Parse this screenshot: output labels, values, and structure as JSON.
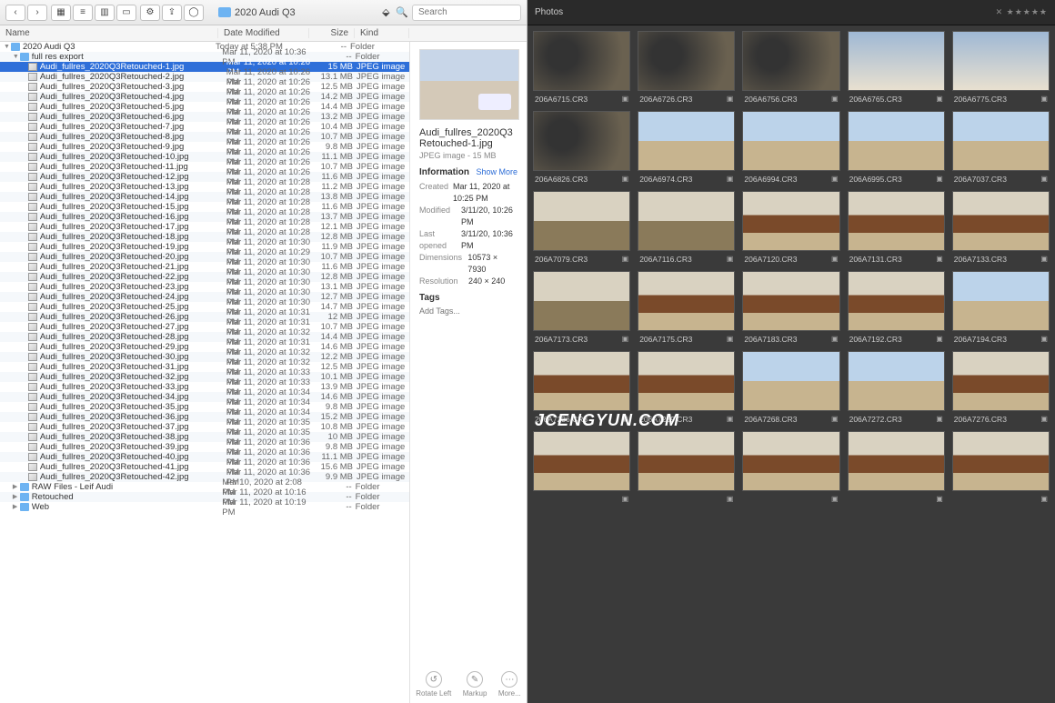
{
  "finder": {
    "path_folder": "2020 Audi Q3",
    "search": {
      "placeholder": "Search"
    },
    "dropbox_icon": "dropbox",
    "columns": {
      "name": "Name",
      "date": "Date Modified",
      "size": "Size",
      "kind": "Kind"
    },
    "tree": [
      {
        "name": "2020 Audi Q3",
        "date": "Today at 5:38 PM",
        "size": "--",
        "kind": "Folder",
        "type": "folder",
        "depth": 0,
        "expanded": true
      },
      {
        "name": "full res export",
        "date": "Mar 11, 2020 at 10:36 PM",
        "size": "--",
        "kind": "Folder",
        "type": "folder",
        "depth": 1,
        "expanded": true
      },
      {
        "name": "Audi_fullres_2020Q3Retouched-1.jpg",
        "date": "Mar 11, 2020 at 10:26 PM",
        "size": "15 MB",
        "kind": "JPEG image",
        "type": "jpg",
        "depth": 2,
        "selected": true
      },
      {
        "name": "Audi_fullres_2020Q3Retouched-2.jpg",
        "date": "Mar 11, 2020 at 10:26 PM",
        "size": "13.1 MB",
        "kind": "JPEG image",
        "type": "jpg",
        "depth": 2
      },
      {
        "name": "Audi_fullres_2020Q3Retouched-3.jpg",
        "date": "Mar 11, 2020 at 10:26 PM",
        "size": "12.5 MB",
        "kind": "JPEG image",
        "type": "jpg",
        "depth": 2
      },
      {
        "name": "Audi_fullres_2020Q3Retouched-4.jpg",
        "date": "Mar 11, 2020 at 10:26 PM",
        "size": "14.2 MB",
        "kind": "JPEG image",
        "type": "jpg",
        "depth": 2
      },
      {
        "name": "Audi_fullres_2020Q3Retouched-5.jpg",
        "date": "Mar 11, 2020 at 10:26 PM",
        "size": "14.4 MB",
        "kind": "JPEG image",
        "type": "jpg",
        "depth": 2
      },
      {
        "name": "Audi_fullres_2020Q3Retouched-6.jpg",
        "date": "Mar 11, 2020 at 10:26 PM",
        "size": "13.2 MB",
        "kind": "JPEG image",
        "type": "jpg",
        "depth": 2
      },
      {
        "name": "Audi_fullres_2020Q3Retouched-7.jpg",
        "date": "Mar 11, 2020 at 10:26 PM",
        "size": "10.4 MB",
        "kind": "JPEG image",
        "type": "jpg",
        "depth": 2
      },
      {
        "name": "Audi_fullres_2020Q3Retouched-8.jpg",
        "date": "Mar 11, 2020 at 10:26 PM",
        "size": "10.7 MB",
        "kind": "JPEG image",
        "type": "jpg",
        "depth": 2
      },
      {
        "name": "Audi_fullres_2020Q3Retouched-9.jpg",
        "date": "Mar 11, 2020 at 10:26 PM",
        "size": "9.8 MB",
        "kind": "JPEG image",
        "type": "jpg",
        "depth": 2
      },
      {
        "name": "Audi_fullres_2020Q3Retouched-10.jpg",
        "date": "Mar 11, 2020 at 10:26 PM",
        "size": "11.1 MB",
        "kind": "JPEG image",
        "type": "jpg",
        "depth": 2
      },
      {
        "name": "Audi_fullres_2020Q3Retouched-11.jpg",
        "date": "Mar 11, 2020 at 10:26 PM",
        "size": "10.7 MB",
        "kind": "JPEG image",
        "type": "jpg",
        "depth": 2
      },
      {
        "name": "Audi_fullres_2020Q3Retouched-12.jpg",
        "date": "Mar 11, 2020 at 10:26 PM",
        "size": "11.6 MB",
        "kind": "JPEG image",
        "type": "jpg",
        "depth": 2
      },
      {
        "name": "Audi_fullres_2020Q3Retouched-13.jpg",
        "date": "Mar 11, 2020 at 10:28 PM",
        "size": "11.2 MB",
        "kind": "JPEG image",
        "type": "jpg",
        "depth": 2
      },
      {
        "name": "Audi_fullres_2020Q3Retouched-14.jpg",
        "date": "Mar 11, 2020 at 10:28 PM",
        "size": "13.8 MB",
        "kind": "JPEG image",
        "type": "jpg",
        "depth": 2
      },
      {
        "name": "Audi_fullres_2020Q3Retouched-15.jpg",
        "date": "Mar 11, 2020 at 10:28 PM",
        "size": "11.6 MB",
        "kind": "JPEG image",
        "type": "jpg",
        "depth": 2
      },
      {
        "name": "Audi_fullres_2020Q3Retouched-16.jpg",
        "date": "Mar 11, 2020 at 10:28 PM",
        "size": "13.7 MB",
        "kind": "JPEG image",
        "type": "jpg",
        "depth": 2
      },
      {
        "name": "Audi_fullres_2020Q3Retouched-17.jpg",
        "date": "Mar 11, 2020 at 10:28 PM",
        "size": "12.1 MB",
        "kind": "JPEG image",
        "type": "jpg",
        "depth": 2
      },
      {
        "name": "Audi_fullres_2020Q3Retouched-18.jpg",
        "date": "Mar 11, 2020 at 10:28 PM",
        "size": "12.8 MB",
        "kind": "JPEG image",
        "type": "jpg",
        "depth": 2
      },
      {
        "name": "Audi_fullres_2020Q3Retouched-19.jpg",
        "date": "Mar 11, 2020 at 10:30 PM",
        "size": "11.9 MB",
        "kind": "JPEG image",
        "type": "jpg",
        "depth": 2
      },
      {
        "name": "Audi_fullres_2020Q3Retouched-20.jpg",
        "date": "Mar 11, 2020 at 10:29 PM",
        "size": "10.7 MB",
        "kind": "JPEG image",
        "type": "jpg",
        "depth": 2
      },
      {
        "name": "Audi_fullres_2020Q3Retouched-21.jpg",
        "date": "Mar 11, 2020 at 10:30 PM",
        "size": "11.6 MB",
        "kind": "JPEG image",
        "type": "jpg",
        "depth": 2
      },
      {
        "name": "Audi_fullres_2020Q3Retouched-22.jpg",
        "date": "Mar 11, 2020 at 10:30 PM",
        "size": "12.8 MB",
        "kind": "JPEG image",
        "type": "jpg",
        "depth": 2
      },
      {
        "name": "Audi_fullres_2020Q3Retouched-23.jpg",
        "date": "Mar 11, 2020 at 10:30 PM",
        "size": "13.1 MB",
        "kind": "JPEG image",
        "type": "jpg",
        "depth": 2
      },
      {
        "name": "Audi_fullres_2020Q3Retouched-24.jpg",
        "date": "Mar 11, 2020 at 10:30 PM",
        "size": "12.7 MB",
        "kind": "JPEG image",
        "type": "jpg",
        "depth": 2
      },
      {
        "name": "Audi_fullres_2020Q3Retouched-25.jpg",
        "date": "Mar 11, 2020 at 10:30 PM",
        "size": "14.7 MB",
        "kind": "JPEG image",
        "type": "jpg",
        "depth": 2
      },
      {
        "name": "Audi_fullres_2020Q3Retouched-26.jpg",
        "date": "Mar 11, 2020 at 10:31 PM",
        "size": "12 MB",
        "kind": "JPEG image",
        "type": "jpg",
        "depth": 2
      },
      {
        "name": "Audi_fullres_2020Q3Retouched-27.jpg",
        "date": "Mar 11, 2020 at 10:31 PM",
        "size": "10.7 MB",
        "kind": "JPEG image",
        "type": "jpg",
        "depth": 2
      },
      {
        "name": "Audi_fullres_2020Q3Retouched-28.jpg",
        "date": "Mar 11, 2020 at 10:32 PM",
        "size": "14.4 MB",
        "kind": "JPEG image",
        "type": "jpg",
        "depth": 2
      },
      {
        "name": "Audi_fullres_2020Q3Retouched-29.jpg",
        "date": "Mar 11, 2020 at 10:31 PM",
        "size": "14.6 MB",
        "kind": "JPEG image",
        "type": "jpg",
        "depth": 2
      },
      {
        "name": "Audi_fullres_2020Q3Retouched-30.jpg",
        "date": "Mar 11, 2020 at 10:32 PM",
        "size": "12.2 MB",
        "kind": "JPEG image",
        "type": "jpg",
        "depth": 2
      },
      {
        "name": "Audi_fullres_2020Q3Retouched-31.jpg",
        "date": "Mar 11, 2020 at 10:32 PM",
        "size": "12.5 MB",
        "kind": "JPEG image",
        "type": "jpg",
        "depth": 2
      },
      {
        "name": "Audi_fullres_2020Q3Retouched-32.jpg",
        "date": "Mar 11, 2020 at 10:33 PM",
        "size": "10.1 MB",
        "kind": "JPEG image",
        "type": "jpg",
        "depth": 2
      },
      {
        "name": "Audi_fullres_2020Q3Retouched-33.jpg",
        "date": "Mar 11, 2020 at 10:33 PM",
        "size": "13.9 MB",
        "kind": "JPEG image",
        "type": "jpg",
        "depth": 2
      },
      {
        "name": "Audi_fullres_2020Q3Retouched-34.jpg",
        "date": "Mar 11, 2020 at 10:34 PM",
        "size": "14.6 MB",
        "kind": "JPEG image",
        "type": "jpg",
        "depth": 2
      },
      {
        "name": "Audi_fullres_2020Q3Retouched-35.jpg",
        "date": "Mar 11, 2020 at 10:34 PM",
        "size": "9.8 MB",
        "kind": "JPEG image",
        "type": "jpg",
        "depth": 2
      },
      {
        "name": "Audi_fullres_2020Q3Retouched-36.jpg",
        "date": "Mar 11, 2020 at 10:34 PM",
        "size": "15.2 MB",
        "kind": "JPEG image",
        "type": "jpg",
        "depth": 2
      },
      {
        "name": "Audi_fullres_2020Q3Retouched-37.jpg",
        "date": "Mar 11, 2020 at 10:35 PM",
        "size": "10.8 MB",
        "kind": "JPEG image",
        "type": "jpg",
        "depth": 2
      },
      {
        "name": "Audi_fullres_2020Q3Retouched-38.jpg",
        "date": "Mar 11, 2020 at 10:35 PM",
        "size": "10 MB",
        "kind": "JPEG image",
        "type": "jpg",
        "depth": 2
      },
      {
        "name": "Audi_fullres_2020Q3Retouched-39.jpg",
        "date": "Mar 11, 2020 at 10:36 PM",
        "size": "9.8 MB",
        "kind": "JPEG image",
        "type": "jpg",
        "depth": 2
      },
      {
        "name": "Audi_fullres_2020Q3Retouched-40.jpg",
        "date": "Mar 11, 2020 at 10:36 PM",
        "size": "11.1 MB",
        "kind": "JPEG image",
        "type": "jpg",
        "depth": 2
      },
      {
        "name": "Audi_fullres_2020Q3Retouched-41.jpg",
        "date": "Mar 11, 2020 at 10:36 PM",
        "size": "15.6 MB",
        "kind": "JPEG image",
        "type": "jpg",
        "depth": 2
      },
      {
        "name": "Audi_fullres_2020Q3Retouched-42.jpg",
        "date": "Mar 11, 2020 at 10:36 PM",
        "size": "9.9 MB",
        "kind": "JPEG image",
        "type": "jpg",
        "depth": 2
      },
      {
        "name": "RAW Files - Leif Audi",
        "date": "Mar 10, 2020 at 2:08 PM",
        "size": "--",
        "kind": "Folder",
        "type": "folder",
        "depth": 1
      },
      {
        "name": "Retouched",
        "date": "Mar 11, 2020 at 10:16 PM",
        "size": "--",
        "kind": "Folder",
        "type": "folder",
        "depth": 1
      },
      {
        "name": "Web",
        "date": "Mar 11, 2020 at 10:19 PM",
        "size": "--",
        "kind": "Folder",
        "type": "folder",
        "depth": 1
      }
    ],
    "preview": {
      "filename": "Audi_fullres_2020Q3Retouched-1.jpg",
      "subtitle": "JPEG image - 15 MB",
      "info_label": "Information",
      "show_more": "Show More",
      "rows": [
        {
          "k": "Created",
          "v": "Mar 11, 2020 at 10:25 PM"
        },
        {
          "k": "Modified",
          "v": "3/11/20, 10:26 PM"
        },
        {
          "k": "Last opened",
          "v": "3/11/20, 10:36 PM"
        },
        {
          "k": "Dimensions",
          "v": "10573 × 7930"
        },
        {
          "k": "Resolution",
          "v": "240 × 240"
        }
      ],
      "tags_label": "Tags",
      "tags_placeholder": "Add Tags...",
      "actions": {
        "rotate": "Rotate Left",
        "markup": "Markup",
        "more": "More..."
      }
    }
  },
  "photos": {
    "tab_label": "Photos",
    "rating_widget": "✕ ★★★★★",
    "thumbs": [
      {
        "name": "206A6715.CR3",
        "cls": "cockpit"
      },
      {
        "name": "206A6726.CR3",
        "cls": "cockpit"
      },
      {
        "name": "206A6756.CR3",
        "cls": "cockpit"
      },
      {
        "name": "206A6765.CR3",
        "cls": "sky"
      },
      {
        "name": "206A6775.CR3",
        "cls": "sky"
      },
      {
        "name": "206A6826.CR3",
        "cls": "cockpit"
      },
      {
        "name": "206A6974.CR3",
        "cls": "plane"
      },
      {
        "name": "206A6994.CR3",
        "cls": "plane"
      },
      {
        "name": "206A6995.CR3",
        "cls": "plane"
      },
      {
        "name": "206A7037.CR3",
        "cls": "plane"
      },
      {
        "name": "206A7079.CR3",
        "cls": "car"
      },
      {
        "name": "206A7116.CR3",
        "cls": "car"
      },
      {
        "name": "206A7120.CR3",
        "cls": "person"
      },
      {
        "name": "206A7131.CR3",
        "cls": "person"
      },
      {
        "name": "206A7133.CR3",
        "cls": "person"
      },
      {
        "name": "206A7173.CR3",
        "cls": "car"
      },
      {
        "name": "206A7175.CR3",
        "cls": "person"
      },
      {
        "name": "206A7183.CR3",
        "cls": "person"
      },
      {
        "name": "206A7192.CR3",
        "cls": "person"
      },
      {
        "name": "206A7194.CR3",
        "cls": "plane"
      },
      {
        "name": "206A7236.CR3",
        "cls": "person"
      },
      {
        "name": "206A7259.CR3",
        "cls": "person"
      },
      {
        "name": "206A7268.CR3",
        "cls": "plane"
      },
      {
        "name": "206A7272.CR3",
        "cls": "plane"
      },
      {
        "name": "206A7276.CR3",
        "cls": "person"
      },
      {
        "name": "",
        "cls": "person"
      },
      {
        "name": "",
        "cls": "person"
      },
      {
        "name": "",
        "cls": "person"
      },
      {
        "name": "",
        "cls": "person"
      },
      {
        "name": "",
        "cls": "person"
      }
    ]
  },
  "watermark": "JCENGYUN.COM"
}
